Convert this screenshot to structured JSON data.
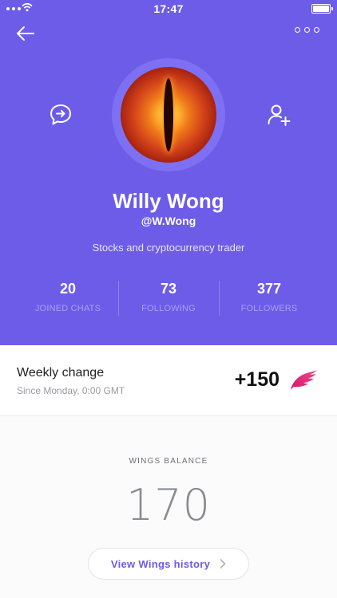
{
  "status_bar": {
    "time": "17:47"
  },
  "profile": {
    "name": "Willy Wong",
    "handle": "@W.Wong",
    "bio": "Stocks and cryptocurrency trader"
  },
  "stats": [
    {
      "value": "20",
      "label": "JOINED CHATS"
    },
    {
      "value": "73",
      "label": "FOLLOWING"
    },
    {
      "value": "377",
      "label": "FOLLOWERS"
    }
  ],
  "weekly": {
    "title": "Weekly change",
    "subtitle": "Since Monday, 0:00 GMT",
    "value": "+150"
  },
  "wings": {
    "label": "WINGS BALANCE",
    "balance": "170",
    "history_button": "View Wings history"
  },
  "colors": {
    "accent": "#6c5ce7",
    "wing": "#e5286c"
  },
  "icons": [
    "back-arrow-icon",
    "more-icon",
    "chat-icon",
    "add-user-icon",
    "wing-icon",
    "chevron-right-icon"
  ]
}
